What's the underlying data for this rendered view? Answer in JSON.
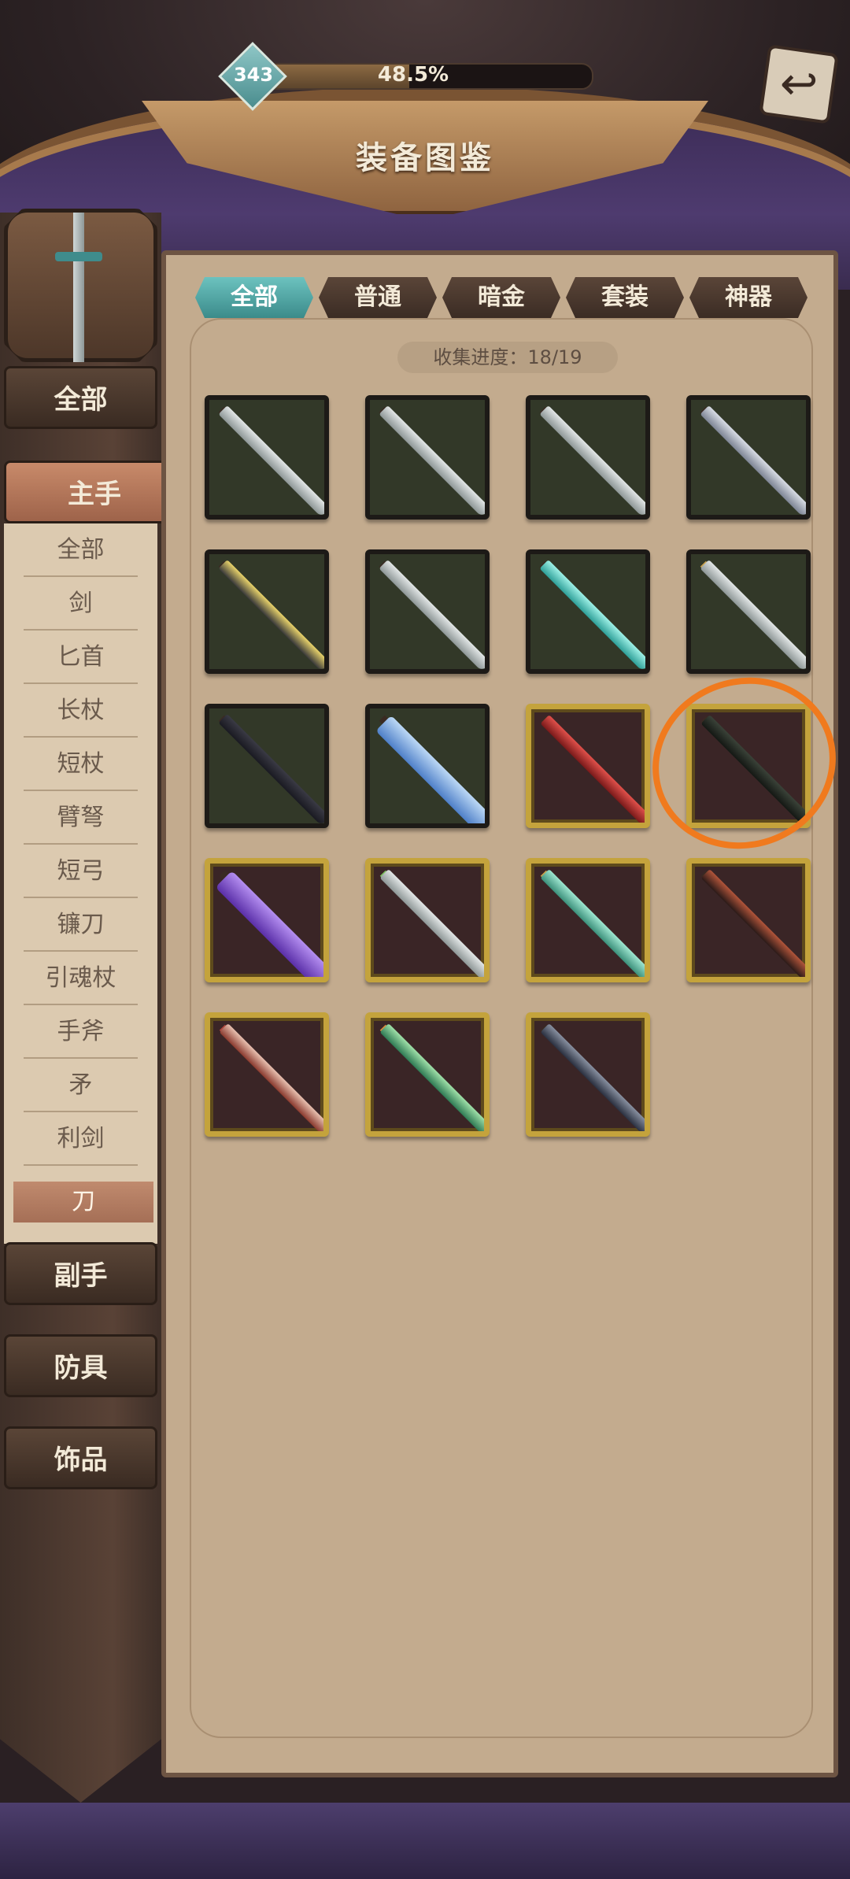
{
  "header": {
    "title": "装备图鉴",
    "level": "343",
    "progress_text": "48.5%",
    "progress_fraction": 0.485,
    "back_icon": "back-arrow-icon"
  },
  "sidebar": {
    "categories": [
      {
        "label": "全部"
      },
      {
        "label": "主手",
        "active": true
      },
      {
        "label": "副手"
      },
      {
        "label": "防具"
      },
      {
        "label": "饰品"
      }
    ],
    "subcategories": [
      {
        "label": "全部"
      },
      {
        "label": "剑"
      },
      {
        "label": "匕首"
      },
      {
        "label": "长杖"
      },
      {
        "label": "短杖"
      },
      {
        "label": "臂弩"
      },
      {
        "label": "短弓"
      },
      {
        "label": "镰刀"
      },
      {
        "label": "引魂杖"
      },
      {
        "label": "手斧"
      },
      {
        "label": "矛"
      },
      {
        "label": "利剑"
      },
      {
        "label": "刀",
        "active": true
      }
    ]
  },
  "tabs": [
    {
      "label": "全部",
      "active": true
    },
    {
      "label": "普通"
    },
    {
      "label": "暗金"
    },
    {
      "label": "套装"
    },
    {
      "label": "神器"
    }
  ],
  "collection": {
    "label": "收集进度：18/19"
  },
  "colors": {
    "accent_teal": "#4fa7a5",
    "gold_frame": "#c4a33c",
    "annotation_orange": "#f07a1e"
  }
}
